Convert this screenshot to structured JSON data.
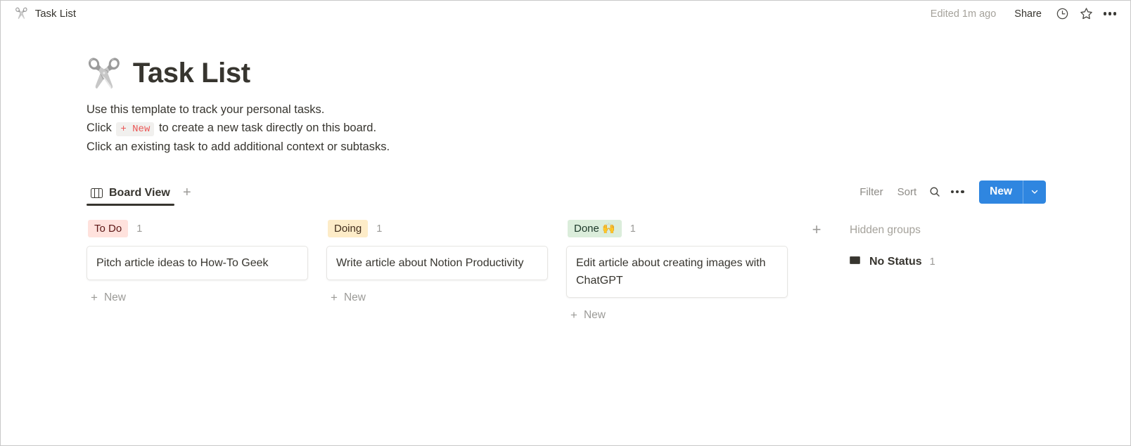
{
  "topbar": {
    "breadcrumb_emoji": "✂️",
    "breadcrumb_title": "Task List",
    "edited_label": "Edited 1m ago",
    "share_label": "Share",
    "icons": {
      "history": "clock-icon",
      "favorite": "star-icon",
      "more": "more-options-icon"
    }
  },
  "page": {
    "title_emoji": "✂️",
    "title": "Task List",
    "description": {
      "line1": "Use this template to track your personal tasks.",
      "line2_before": "Click",
      "line2_code": "+ New",
      "line2_after": "to create a new task directly on this board.",
      "line3": "Click an existing task to add additional context or subtasks."
    }
  },
  "view_toolbar": {
    "tabs": [
      {
        "label": "Board View",
        "icon": "board-view-icon",
        "active": true
      }
    ],
    "add_view_label": "+",
    "filter_label": "Filter",
    "sort_label": "Sort",
    "search_icon": "search-icon",
    "more_icon": "more-options-icon",
    "new_button": {
      "label": "New",
      "caret": "chevron-down-icon",
      "color": "#2f86e0"
    }
  },
  "board": {
    "add_group_label": "+",
    "columns": [
      {
        "status": "To Do",
        "badge_bg": "#ffe2dd",
        "badge_color": "#5d1715",
        "count": "1",
        "new_label": "New",
        "cards": [
          {
            "title": "Pitch article ideas to How-To Geek"
          }
        ]
      },
      {
        "status": "Doing",
        "badge_bg": "#fdecc8",
        "badge_color": "#402c1b",
        "count": "1",
        "new_label": "New",
        "cards": [
          {
            "title": "Write article about Notion Productivity"
          }
        ]
      },
      {
        "status": "Done 🙌",
        "badge_bg": "#dbeddb",
        "badge_color": "#1c3829",
        "count": "1",
        "new_label": "New",
        "cards": [
          {
            "title": "Edit article about creating images with ChatGPT"
          }
        ]
      }
    ],
    "hidden_groups": {
      "title": "Hidden groups",
      "items": [
        {
          "icon": "inbox-icon",
          "name": "No Status",
          "count": "1"
        }
      ]
    }
  }
}
